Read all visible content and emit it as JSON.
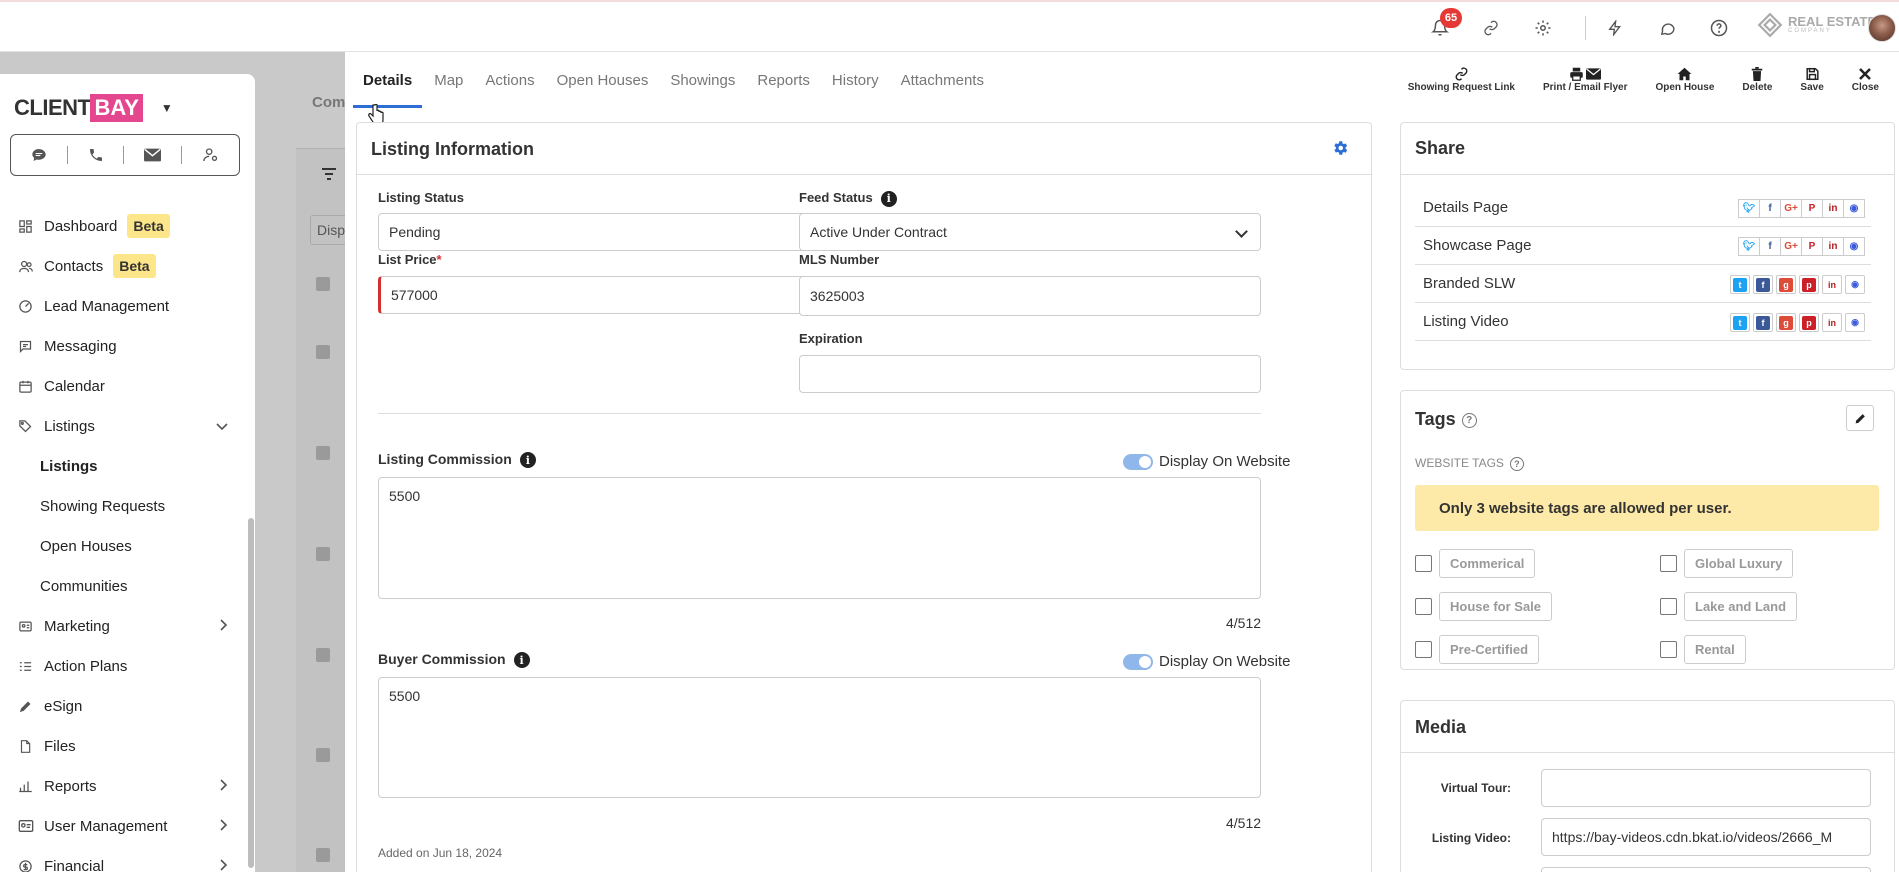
{
  "topbar": {
    "notification_count": "65",
    "brand_name": "REAL ESTATE",
    "brand_sub": "COMPANY"
  },
  "sidebar": {
    "logo_left": "CLIENT",
    "logo_right": "BAY",
    "items": [
      {
        "label": "Dashboard",
        "badge": "Beta",
        "icon": "dashboard-icon"
      },
      {
        "label": "Contacts",
        "badge": "Beta",
        "icon": "contacts-icon"
      },
      {
        "label": "Lead Management",
        "icon": "lead-icon"
      },
      {
        "label": "Messaging",
        "icon": "messaging-icon"
      },
      {
        "label": "Calendar",
        "icon": "calendar-icon"
      },
      {
        "label": "Listings",
        "icon": "listings-icon"
      },
      {
        "label": "Listings"
      },
      {
        "label": "Showing Requests"
      },
      {
        "label": "Open Houses"
      },
      {
        "label": "Communities"
      },
      {
        "label": "Marketing",
        "icon": "marketing-icon"
      },
      {
        "label": "Action Plans",
        "icon": "action-plans-icon"
      },
      {
        "label": "eSign",
        "icon": "esign-icon"
      },
      {
        "label": "Files",
        "icon": "files-icon"
      },
      {
        "label": "Reports",
        "icon": "reports-icon"
      },
      {
        "label": "User Management",
        "icon": "user-management-icon"
      },
      {
        "label": "Financial",
        "icon": "financial-icon"
      }
    ]
  },
  "background": {
    "header_fragment": "Com",
    "filter_fragment": "Disp"
  },
  "tabs": [
    "Details",
    "Map",
    "Actions",
    "Open Houses",
    "Showings",
    "Reports",
    "History",
    "Attachments"
  ],
  "toolbar": {
    "showing_request_link": "Showing Request Link",
    "print_email_flyer": "Print / Email Flyer",
    "open_house": "Open House",
    "delete": "Delete",
    "save": "Save",
    "close": "Close"
  },
  "listing_info": {
    "title": "Listing Information",
    "listing_status_label": "Listing Status",
    "listing_status_value": "Pending",
    "feed_status_label": "Feed Status",
    "feed_status_value": "Active Under Contract",
    "list_price_label": "List Price",
    "required_mark": "*",
    "list_price_value": "577000",
    "mls_label": "MLS Number",
    "mls_value": "3625003",
    "expiration_label": "Expiration",
    "expiration_value": "",
    "listing_commission_label": "Listing Commission",
    "listing_commission_value": "5500",
    "listing_commission_counter": "4/512",
    "display_on_website": "Display On Website",
    "buyer_commission_label": "Buyer Commission",
    "buyer_commission_value": "5500",
    "buyer_commission_counter": "4/512",
    "added_on": "Added on Jun 18, 2024"
  },
  "share": {
    "title": "Share",
    "rows": [
      "Details Page",
      "Showcase Page",
      "Branded SLW",
      "Listing Video"
    ]
  },
  "tags": {
    "title": "Tags",
    "website_tags_label": "WEBSITE TAGS",
    "alert": "Only 3 website tags are allowed per user.",
    "items": [
      "Commerical",
      "Global Luxury",
      "House for Sale",
      "Lake and Land",
      "Pre-Certified",
      "Rental"
    ]
  },
  "media": {
    "title": "Media",
    "virtual_tour_label": "Virtual Tour:",
    "virtual_tour_value": "",
    "listing_video_label": "Listing Video:",
    "listing_video_value": "https://bay-videos.cdn.bkat.io/videos/2666_M"
  },
  "colors": {
    "accent": "#2c6ed5",
    "brand_pink": "#e5478e",
    "beta_badge": "#fde58a",
    "alert_yellow": "#fde9a8",
    "notification_red": "#e53935"
  }
}
